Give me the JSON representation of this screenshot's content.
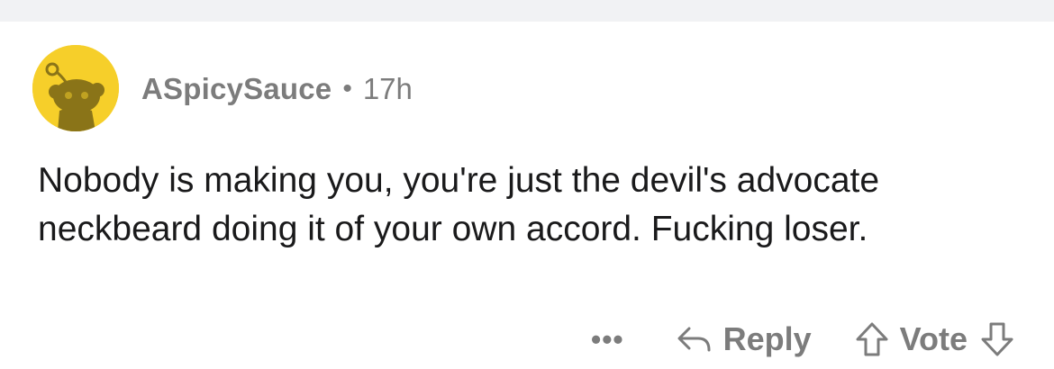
{
  "comment": {
    "username": "ASpicySauce",
    "separator": "•",
    "time": "17h",
    "body": "Nobody is making you, you're just the devil's advocate neckbeard doing it of your own accord. Fucking loser.",
    "avatar_icon": "snoo-avatar-icon",
    "avatar_color": "#f6cf2a"
  },
  "actions": {
    "more_label": "•••",
    "more_icon": "more-options-icon",
    "reply_label": "Reply",
    "reply_icon": "reply-arrow-icon",
    "vote_label": "Vote",
    "upvote_icon": "upvote-arrow-icon",
    "downvote_icon": "downvote-arrow-icon"
  },
  "colors": {
    "text_primary": "#1a1a1b",
    "text_secondary": "#7c7c7c",
    "background_strip": "#f1f2f4"
  }
}
